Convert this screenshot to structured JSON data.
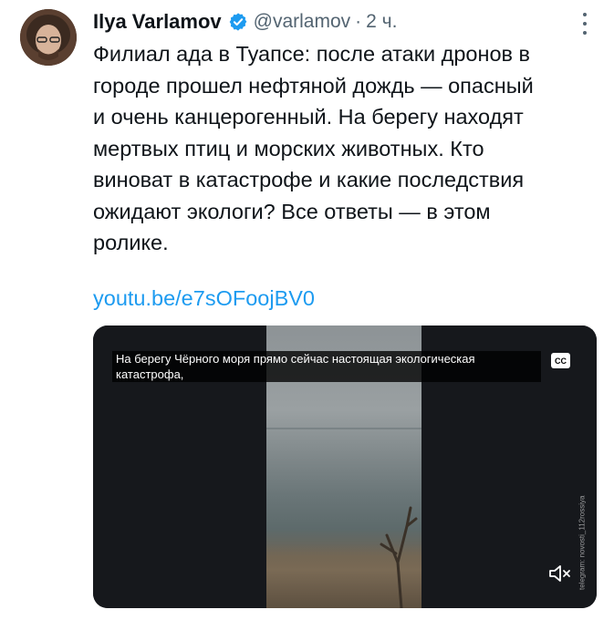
{
  "author": {
    "name": "Ilya Varlamov",
    "handle": "@varlamov",
    "separator": "·",
    "time": "2 ч.",
    "verified_color": "#1d9bf0"
  },
  "tweet": {
    "text": "Филиал ада в Туапсе: после атаки дронов в\nгороде прошел нефтяной дождь — опасный\nи очень канцерогенный. На берегу находят\nмертвых птиц и морских животных. Кто\nвиноват в катастрофе и какие последствия\nожидают экологи? Все ответы — в этом\nролике.",
    "link": "youtu.be/e7sOFoojBV0",
    "link_color": "#1d9bf0"
  },
  "media": {
    "caption": "На берегу Чёрного моря прямо сейчас настоящая экологическая катастрофа,",
    "cc_label": "CC",
    "watermark": "telegram: novosti_112rossiya"
  },
  "icons": {
    "avatar": "avatar-photo",
    "verified": "verified-badge-icon",
    "more": "more-options-icon",
    "cc": "closed-captions-icon",
    "mute": "muted-speaker-icon"
  }
}
